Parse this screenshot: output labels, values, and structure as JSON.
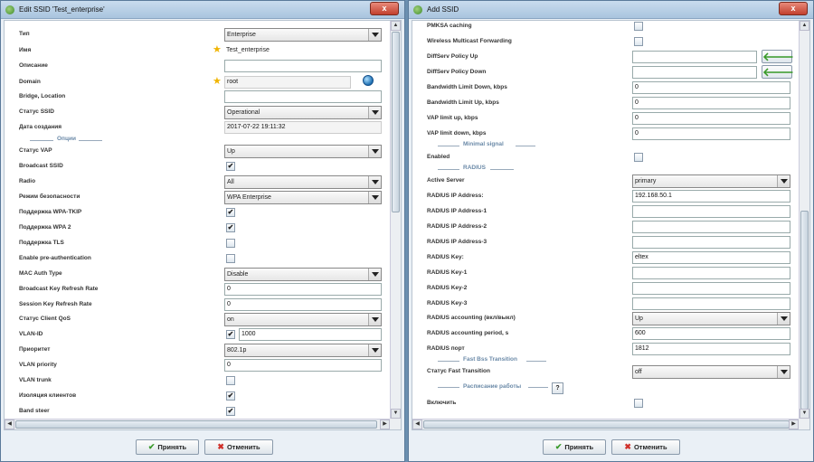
{
  "left_window": {
    "title": "Edit SSID 'Test_enterprise'",
    "close_label": "x",
    "accept_label": "Принять",
    "cancel_label": "Отменить",
    "rows": {
      "type": {
        "label": "Тип",
        "value": "Enterprise"
      },
      "name": {
        "label": "Имя",
        "value": "Test_enterprise"
      },
      "description": {
        "label": "Описание",
        "value": ""
      },
      "domain": {
        "label": "Domain",
        "value": "root"
      },
      "bridge": {
        "label": "Bridge, Location",
        "value": ""
      },
      "ssid_status": {
        "label": "Статус SSID",
        "value": "Operational"
      },
      "created": {
        "label": "Дата создания",
        "value": "2017-07-22 19:11:32"
      },
      "options_section": "Опции",
      "vap_status": {
        "label": "Статус VAP",
        "value": "Up"
      },
      "broadcast_ssid": {
        "label": "Broadcast SSID",
        "checked": true
      },
      "radio": {
        "label": "Radio",
        "value": "All"
      },
      "security_mode": {
        "label": "Режим безопасности",
        "value": "WPA Enterprise"
      },
      "wpa_tkip": {
        "label": "Поддержка WPA-TKIP",
        "checked": true
      },
      "wpa2": {
        "label": "Поддержка WPA 2",
        "checked": true
      },
      "tls": {
        "label": "Поддержка TLS",
        "checked": false
      },
      "pre_auth": {
        "label": "Enable pre-authentication",
        "checked": false
      },
      "mac_auth": {
        "label": "MAC Auth Type",
        "value": "Disable"
      },
      "bcast_key": {
        "label": "Broadcast Key Refresh Rate",
        "value": "0"
      },
      "session_key": {
        "label": "Session Key Refresh Rate",
        "value": "0"
      },
      "qos": {
        "label": "Статус Client QoS",
        "value": "on"
      },
      "vlan_id": {
        "label": "VLAN-ID",
        "checked": true,
        "value": "1000"
      },
      "priority": {
        "label": "Приоритет",
        "value": "802.1p"
      },
      "vlan_priority": {
        "label": "VLAN priority",
        "value": "0"
      },
      "vlan_trunk": {
        "label": "VLAN trunk",
        "checked": false
      },
      "client_isolation": {
        "label": "Изоляция клиентов",
        "checked": true
      },
      "band_steer": {
        "label": "Band steer",
        "checked": true
      }
    }
  },
  "right_window": {
    "title": "Add SSID",
    "close_label": "x",
    "accept_label": "Принять",
    "cancel_label": "Отменить",
    "rows": {
      "pmksa": {
        "label": "PMKSA caching",
        "checked": false
      },
      "wmf": {
        "label": "Wireless Multicast Forwarding",
        "checked": false
      },
      "diffserv_up": {
        "label": "DiffServ Policy Up",
        "value": ""
      },
      "diffserv_down": {
        "label": "DiffServ Policy Down",
        "value": ""
      },
      "bw_down": {
        "label": "Bandwidth Limit Down, kbps",
        "value": "0"
      },
      "bw_up": {
        "label": "Bandwidth Limit Up, kbps",
        "value": "0"
      },
      "vap_up": {
        "label": "VAP limit up, kbps",
        "value": "0"
      },
      "vap_down": {
        "label": "VAP limit down, kbps",
        "value": "0"
      },
      "minimal_signal_section": "Minimal signal",
      "enabled": {
        "label": "Enabled",
        "checked": false
      },
      "radius_section": "RADIUS",
      "active_server": {
        "label": "Active Server",
        "value": "primary"
      },
      "radius_ip": {
        "label": "RADIUS IP Address:",
        "value": "192.168.50.1"
      },
      "radius_ip1": {
        "label": "RADIUS IP Address-1",
        "value": ""
      },
      "radius_ip2": {
        "label": "RADIUS IP Address-2",
        "value": ""
      },
      "radius_ip3": {
        "label": "RADIUS IP Address-3",
        "value": ""
      },
      "radius_key": {
        "label": "RADIUS Key:",
        "value": "eltex"
      },
      "radius_key1": {
        "label": "RADIUS Key-1",
        "value": ""
      },
      "radius_key2": {
        "label": "RADIUS Key-2",
        "value": ""
      },
      "radius_key3": {
        "label": "RADIUS Key-3",
        "value": ""
      },
      "radius_acct": {
        "label": "RADIUS accounting (вкл/выкл)",
        "value": "Up"
      },
      "radius_acct_period": {
        "label": "RADIUS accounting period, s",
        "value": "600"
      },
      "radius_port": {
        "label": "RADIUS порт",
        "value": "1812"
      },
      "fbt_section": "Fast Bss Transition",
      "fbt_status": {
        "label": "Статус Fast Transition",
        "value": "off"
      },
      "schedule_section": "Расписание работы",
      "help_label": "?",
      "enable": {
        "label": "Включить",
        "checked": false
      }
    }
  }
}
